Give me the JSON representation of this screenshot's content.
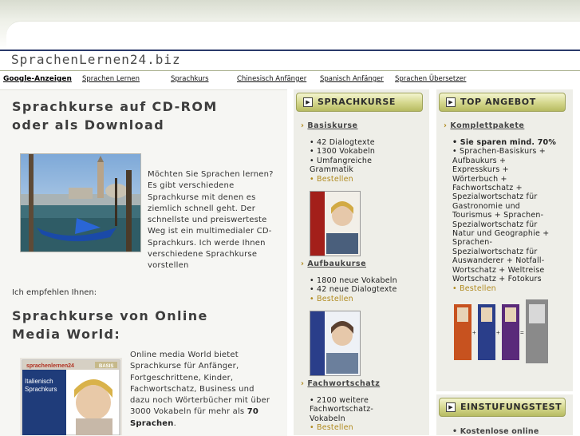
{
  "site": {
    "title": "SprachenLernen24.biz"
  },
  "nav": {
    "google": "Google-Anzeigen",
    "links": [
      "Sprachen Lernen",
      "Sprachkurs",
      "Chinesisch Anfänger",
      "Spanisch Anfänger",
      "Sprachen Übersetzer"
    ]
  },
  "main": {
    "heading1_line1": "Sprachkurse auf CD-ROM",
    "heading1_line2": "oder als Download",
    "intro_lines": [
      "Möchten Sie Sprachen lernen?",
      "Es gibt verschiedene",
      "Sprachkurse mit denen es",
      "ziemlich schnell geht. Der",
      "schnellste und preiswerteste",
      "Weg ist ein multimedialer CD-",
      "Sprachkurs. Ich werde Ihnen",
      "verschiedene Sprachkurse",
      "vorstellen"
    ],
    "recommend": "Ich empfehlen Ihnen:",
    "heading2_line1": "Sprachkurse von Online",
    "heading2_line2": "Media World:",
    "omw_lines": [
      "Online media World bietet",
      "Sprachkurse für Anfänger,",
      "Fortgeschrittene, Kinder,",
      "Fachwortschatz, Business und",
      "dazu noch Wörterbücher mit über",
      "3000 Vokabeln für mehr als"
    ],
    "omw_bold": "70",
    "omw_last_bold": "Sprachen",
    "omw_last_tail": ".",
    "box_brand": "sprachenlernen24",
    "box_level": "BASIS",
    "box_title1": "Italienisch",
    "box_title2": "Sprachkurs"
  },
  "sprachkurse": {
    "header": "SPRACHKURSE",
    "sections": [
      {
        "title": "Basiskurse",
        "items": [
          "• 42 Dialogtexte",
          "• 1300 Vokabeln",
          "• Umfangreiche",
          "Grammatik"
        ],
        "order": "• Bestellen"
      },
      {
        "title": "Aufbaukurse",
        "items": [
          "• 1800 neue Vokabeln",
          "• 42 neue Dialogtexte"
        ],
        "order": "• Bestellen"
      },
      {
        "title": "Fachwortschatz",
        "items": [
          "• 2100 weitere",
          "Fachwortschatz-",
          "Vokabeln"
        ],
        "order": "• Bestellen"
      }
    ]
  },
  "angebot": {
    "header": "TOP ANGEBOT",
    "section": "Komplettpakete",
    "bold_line": "• Sie sparen mind. 70%",
    "lines": [
      "• Sprachen-Basiskurs +",
      "Aufbaukurs +",
      "Expresskurs +",
      "Wörterbuch +",
      "Fachwortschatz +",
      "Spezialwortschatz für",
      "Gastronomie und",
      "Tourismus + Sprachen-",
      "Spezialwortschatz für",
      "Natur und Geographie +",
      "Sprachen-",
      "Spezialwortschatz für",
      "Auswanderer + Notfall-",
      "Wortschatz + Weltreise",
      "Wortschatz + Fotokurs"
    ],
    "order": "• Bestellen"
  },
  "test": {
    "header": "EINSTUFUNGSTEST",
    "item": "• Kostenlose online"
  },
  "colors": {
    "accent": "#b08a1e",
    "header_olive": "#c7ca78",
    "nav_blue": "#2a3a6a"
  }
}
